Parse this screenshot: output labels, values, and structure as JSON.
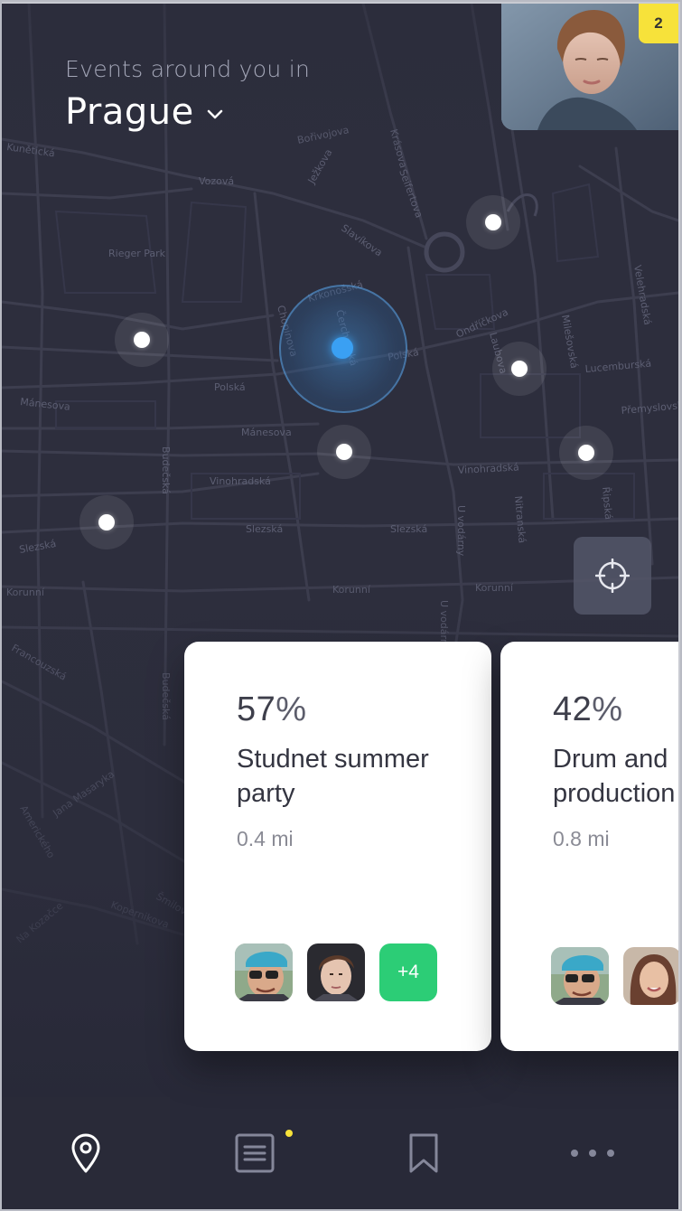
{
  "header": {
    "subtitle": "Events around you in",
    "city": "Prague"
  },
  "notifications": {
    "count": "2"
  },
  "map": {
    "street_labels": [
      "Kunětická",
      "Rieger Park",
      "Vozová",
      "Bořivojova",
      "Ježkova",
      "Slavíkova",
      "Krkonošská",
      "Čerchovská",
      "Chopinova",
      "Polská",
      "Mánesova",
      "Vinohradská",
      "Slezská",
      "Korunní",
      "Francouzská",
      "Budečská",
      "Ondříčkova",
      "Laubova",
      "Milešovská",
      "Lucemburská",
      "Přemyslovská",
      "Řipská",
      "Nitranská",
      "U vodárny",
      "Velehradská",
      "Vinohradská",
      "Jana Masaryka",
      "Amerického",
      "Šmilovského",
      "Kopernikova",
      "Na Kozačce",
      "Krásova",
      "Seifertova"
    ]
  },
  "cards": [
    {
      "percent": "57",
      "percent_symbol": "%",
      "title": "Studnet summer party",
      "distance": "0.4 mi",
      "more_label": "+4"
    },
    {
      "percent": "42",
      "percent_symbol": "%",
      "title": "Drum and production",
      "distance": "0.8 mi"
    }
  ],
  "nav": {
    "items": [
      "map-pin",
      "list",
      "bookmark",
      "more"
    ],
    "active": "map-pin"
  },
  "colors": {
    "background": "#2b2c3b",
    "accent_green": "#2ccd76",
    "badge_yellow": "#f7e23a",
    "location_blue": "#3aa0f3"
  }
}
